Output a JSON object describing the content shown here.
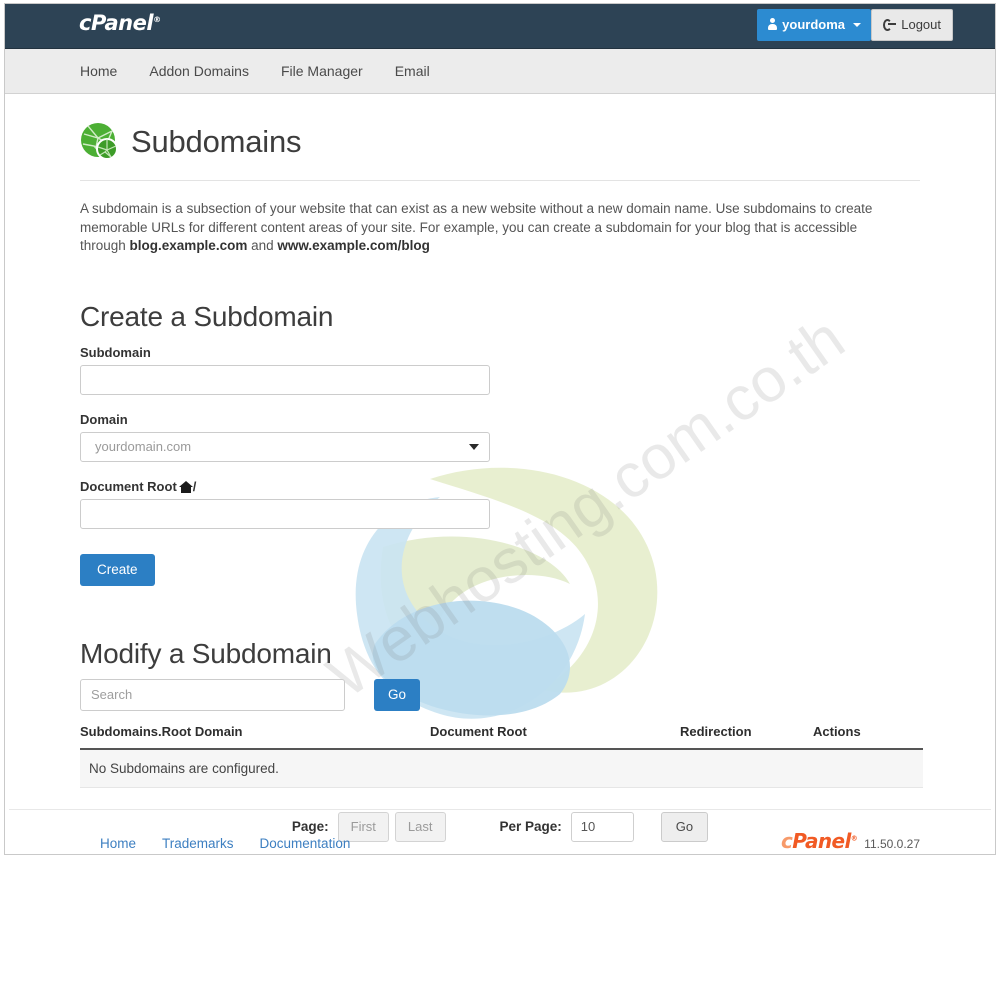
{
  "brand": {
    "header_logo": "cPanel",
    "registered_mark": "®"
  },
  "topbar": {
    "user_button_label": "yourdoma",
    "logout_label": "Logout"
  },
  "nav": {
    "items": [
      {
        "label": "Home"
      },
      {
        "label": "Addon Domains"
      },
      {
        "label": "File Manager"
      },
      {
        "label": "Email"
      }
    ]
  },
  "page": {
    "title": "Subdomains",
    "icon": "globe-magnifier-icon",
    "description_part1": "A subdomain is a subsection of your website that can exist as a new website without a new domain name. Use subdomains to create memorable URLs for different content areas of your site. For example, you can create a subdomain for your blog that is accessible through ",
    "description_bold1": "blog.example.com",
    "description_mid": " and ",
    "description_bold2": "www.example.com/blog"
  },
  "create_section": {
    "heading": "Create a Subdomain",
    "subdomain_label": "Subdomain",
    "subdomain_value": "",
    "subdomain_placeholder": "",
    "domain_label": "Domain",
    "domain_selected": "yourdomain.com",
    "domain_options": [
      "yourdomain.com"
    ],
    "document_root_label": "Document Root",
    "document_root_suffix": "/",
    "document_root_value": "",
    "document_root_placeholder": "",
    "create_button": "Create"
  },
  "modify_section": {
    "heading": "Modify a Subdomain",
    "search_placeholder": "Search",
    "search_value": "",
    "go_button": "Go",
    "table": {
      "columns": [
        "Subdomains.Root Domain",
        "Document Root",
        "Redirection",
        "Actions"
      ],
      "rows": [],
      "empty_message": "No Subdomains are configured."
    },
    "pagination": {
      "page_label": "Page:",
      "first_button": "First",
      "last_button": "Last",
      "per_page_label": "Per Page:",
      "per_page_value": "10",
      "go_button": "Go"
    }
  },
  "footer": {
    "links": [
      {
        "label": "Home"
      },
      {
        "label": "Trademarks"
      },
      {
        "label": "Documentation"
      }
    ],
    "logo_c": "c",
    "logo_panel": "Panel",
    "registered_mark": "®",
    "version": "11.50.0.27"
  },
  "watermark": {
    "text": "Webhosting.com.co.th"
  },
  "colors": {
    "header_bg": "#2d4355",
    "nav_bg": "#ececec",
    "accent_blue": "#2c7fc4",
    "user_blue": "#2c8bd1",
    "cpanel_orange": "#f15a24",
    "cpanel_orange_light": "#f79a6a",
    "globe_green": "#4caf34"
  }
}
